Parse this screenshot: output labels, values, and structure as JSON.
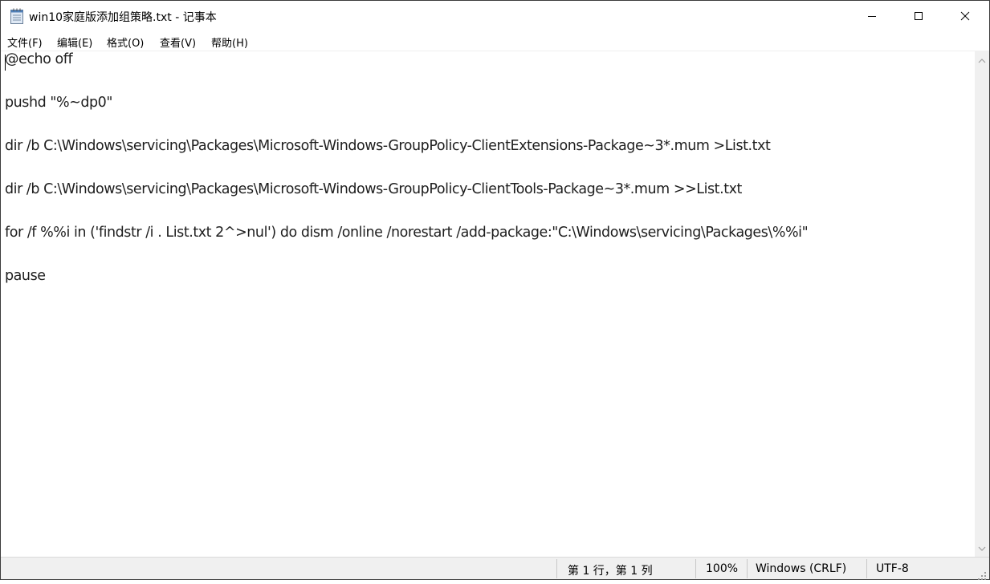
{
  "window": {
    "title": "win10家庭版添加组策略.txt - 记事本",
    "app_icon": "notepad-icon",
    "controls": {
      "minimize_icon": "minimize-icon",
      "maximize_icon": "maximize-icon",
      "close_icon": "close-icon"
    }
  },
  "menu": {
    "items": [
      {
        "label": "文件(F)"
      },
      {
        "label": "编辑(E)"
      },
      {
        "label": "格式(O)"
      },
      {
        "label": "查看(V)"
      },
      {
        "label": "帮助(H)"
      }
    ]
  },
  "editor": {
    "lines": [
      "@echo off",
      "",
      "pushd \"%~dp0\"",
      "",
      "dir /b C:\\Windows\\servicing\\Packages\\Microsoft-Windows-GroupPolicy-ClientExtensions-Package~3*.mum >List.txt",
      "",
      "dir /b C:\\Windows\\servicing\\Packages\\Microsoft-Windows-GroupPolicy-ClientTools-Package~3*.mum >>List.txt",
      "",
      "for /f %%i in ('findstr /i . List.txt 2^>nul') do dism /online /norestart /add-package:\"C:\\Windows\\servicing\\Packages\\%%i\"",
      "",
      "pause"
    ]
  },
  "statusbar": {
    "position": "第 1 行，第 1 列",
    "zoom": "100%",
    "line_ending": "Windows (CRLF)",
    "encoding": "UTF-8"
  },
  "colors": {
    "title_bg": "#ffffff",
    "status_bg": "#f0f0f0",
    "text": "#1e1e1e"
  }
}
